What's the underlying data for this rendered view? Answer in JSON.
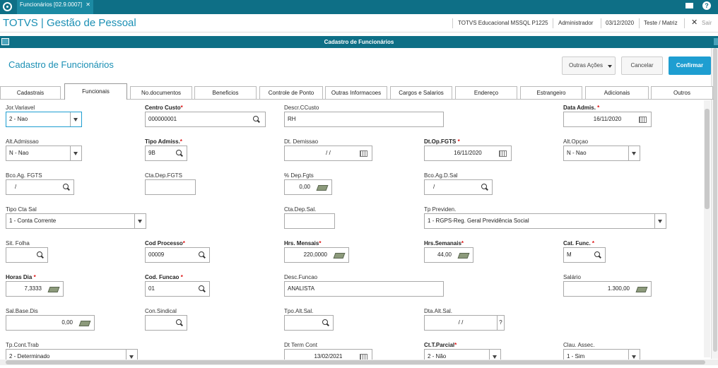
{
  "topbar": {
    "tab_label": "Funcionários [02.9.0007]",
    "tab_close": "✕",
    "help": "?"
  },
  "header": {
    "brand": "TOTVS | Gestão de Pessoal",
    "system": "TOTVS Educacional MSSQL P1225",
    "user": "Administrador",
    "date": "03/12/2020",
    "company": "Teste / Matriz",
    "close": "✕",
    "exit": "Sair"
  },
  "dialog": {
    "title": "Cadastro de Funcionários"
  },
  "page": {
    "title": "Cadastro de Funcionários",
    "other_actions": "Outras Ações",
    "cancel": "Cancelar",
    "confirm": "Confirmar"
  },
  "tabs": [
    "Cadastrais",
    "Funcionais",
    "No.documentos",
    "Beneficios",
    "Controle de Ponto",
    "Outras Informacoes",
    "Cargos e Salarios",
    "Endereço",
    "Estrangeiro",
    "Adicionais",
    "Outros"
  ],
  "active_tab": "Funcionais",
  "fields": {
    "jor_variavel": {
      "label": "Jor.Variavel",
      "value": "2 - Nao"
    },
    "centro_custo": {
      "label": "Centro Custo",
      "value": "000000001"
    },
    "descr_ccusto": {
      "label": "Descr.CCusto",
      "value": "RH"
    },
    "data_admis": {
      "label": "Data Admis.",
      "value": "16/11/2020"
    },
    "alt_admissao": {
      "label": "Alt.Admissao",
      "value": "N - Nao"
    },
    "tipo_admis": {
      "label": "Tipo Admiss.",
      "value": "9B"
    },
    "dt_demissao": {
      "label": "Dt. Demissao",
      "value": "/ /"
    },
    "dt_op_fgts": {
      "label": "Dt.Op.FGTS",
      "value": "16/11/2020"
    },
    "alt_opcao": {
      "label": "Alt.Opçao",
      "value": "N - Nao"
    },
    "bco_ag_fgts": {
      "label": "Bco.Ag. FGTS",
      "value": "/"
    },
    "cta_dep_fgts": {
      "label": "Cta.Dep.FGTS",
      "value": ""
    },
    "pct_dep_fgts": {
      "label": "% Dep.Fgts",
      "value": "0,00"
    },
    "bco_ag_d_sal": {
      "label": "Bco.Ag.D.Sal",
      "value": "/"
    },
    "tipo_cta_sal": {
      "label": "Tipo Cta Sal",
      "value": "1 - Conta Corrente"
    },
    "cta_dep_sal": {
      "label": "Cta.Dep.Sal.",
      "value": ""
    },
    "tp_previden": {
      "label": "Tp Previden.",
      "value": "1 - RGPS-Reg. Geral Previdência Social"
    },
    "sit_folha": {
      "label": "Sit. Folha",
      "value": ""
    },
    "cod_processo": {
      "label": "Cod Processo",
      "value": "00009"
    },
    "hrs_mensais": {
      "label": "Hrs. Mensais",
      "value": "220,0000"
    },
    "hrs_semanais": {
      "label": "Hrs.Semanais",
      "value": "44,00"
    },
    "cat_func": {
      "label": "Cat. Func.",
      "value": "M"
    },
    "horas_dia": {
      "label": "Horas Dia",
      "value": "7,3333"
    },
    "cod_funcao": {
      "label": "Cod. Funcao",
      "value": "01"
    },
    "desc_funcao": {
      "label": "Desc.Funcao",
      "value": "ANALISTA"
    },
    "salario": {
      "label": "Salário",
      "value": "1.300,00"
    },
    "sal_base_dis": {
      "label": "Sal.Base.Dis",
      "value": "0,00"
    },
    "con_sindical": {
      "label": "Con.Sindical",
      "value": ""
    },
    "tpo_alt_sal": {
      "label": "Tpo.Alt.Sal.",
      "value": ""
    },
    "dta_alt_sal": {
      "label": "Dta.Alt.Sal.",
      "value": "/ /",
      "btn": "?"
    },
    "tp_cont_trab": {
      "label": "Tp.Cont.Trab",
      "value": "2 - Determinado"
    },
    "dt_term_cont": {
      "label": "Dt Term Cont",
      "value": "13/02/2021"
    },
    "ct_t_parcial": {
      "label": "Ct.T.Parcial",
      "value": "2 - Não"
    },
    "clau_assec": {
      "label": "Clau. Assec.",
      "value": "1 - Sim"
    }
  },
  "required_mark": "*"
}
